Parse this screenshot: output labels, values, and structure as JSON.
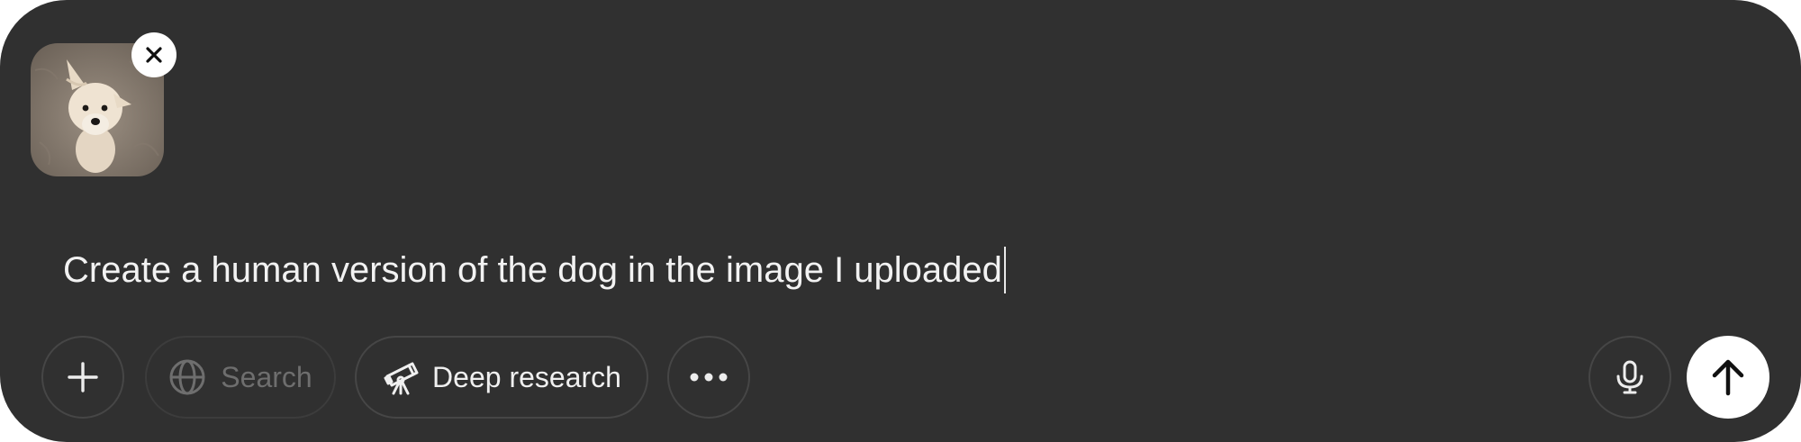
{
  "attachment": {
    "alt": "dog photo",
    "remove_icon": "close-icon"
  },
  "prompt": {
    "text": "Create a human version of the dog in the image I uploaded"
  },
  "toolbar": {
    "add_icon": "plus-icon",
    "search_label": "Search",
    "search_icon": "globe-icon",
    "deep_research_label": "Deep research",
    "deep_research_icon": "telescope-icon",
    "more_icon": "ellipsis-icon",
    "mic_icon": "microphone-icon",
    "send_icon": "arrow-up-icon"
  },
  "colors": {
    "composer_bg": "#303030",
    "pill_border": "#464646",
    "text": "#f2f2f2",
    "muted": "#6e6e6e",
    "send_bg": "#ffffff"
  }
}
